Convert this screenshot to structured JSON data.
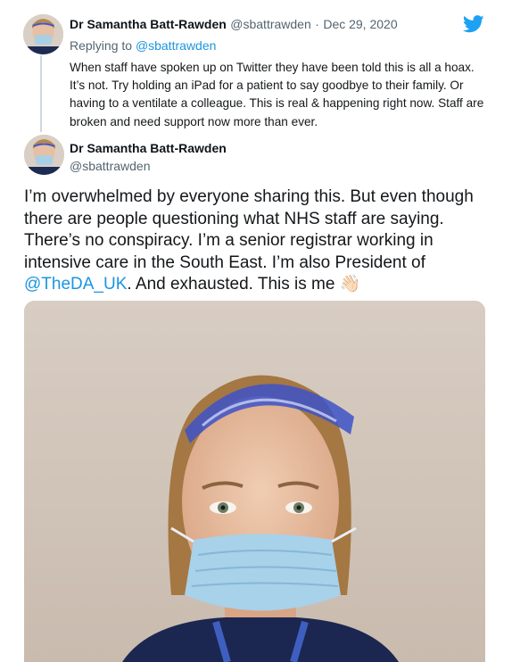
{
  "quoted_tweet": {
    "author_name": "Dr Samantha Batt-Rawden",
    "handle": "@sbattrawden",
    "separator": "·",
    "date": "Dec 29, 2020",
    "replying_prefix": "Replying to",
    "replying_to": "@sbattrawden",
    "text": "When staff have spoken up on Twitter they have been told this is all a hoax. It’s not. Try holding an iPad for a patient to say goodbye to their family. Or having to a ventilate a colleague. This is real & happening right now. Staff are broken and need support now more than ever."
  },
  "main_tweet": {
    "author_name": "Dr Samantha Batt-Rawden",
    "handle": "@sbattrawden",
    "text_before_mention": "I’m overwhelmed by everyone sharing this. But even though there are people questioning what NHS staff are saying. There’s no conspiracy. I’m a senior registrar working in intensive care in the South East. I’m also President of ",
    "mention": "@TheDA_UK",
    "text_after_mention": ". And exhausted. This is me ",
    "emoji": "👋🏻"
  },
  "icons": {
    "logo": "twitter-bird-icon"
  },
  "colors": {
    "link": "#1b95e0",
    "muted": "#536471",
    "text": "#14171a",
    "divider": "#cfd9de"
  }
}
